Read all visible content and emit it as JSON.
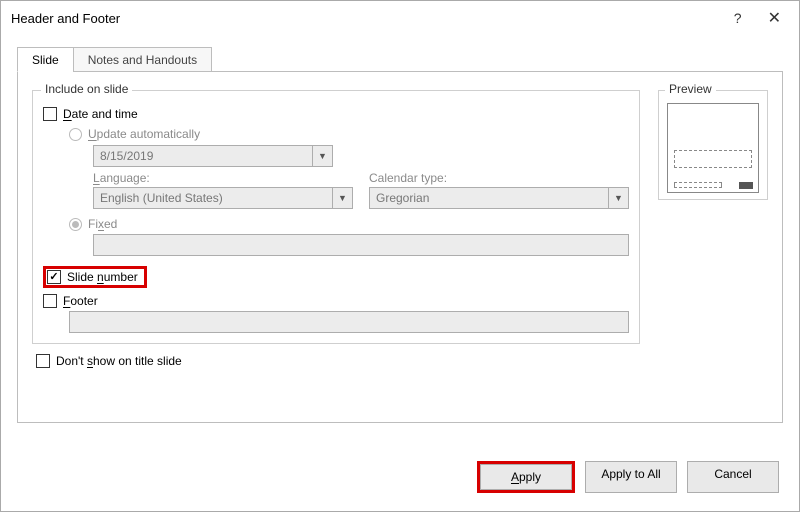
{
  "title": "Header and Footer",
  "tabs": {
    "slide": "Slide",
    "notes": "Notes and Handouts"
  },
  "group": {
    "include": "Include on slide",
    "preview": "Preview"
  },
  "fields": {
    "date_time": "Date and time",
    "update_auto": "Update automatically",
    "date_value": "8/15/2019",
    "language_label": "Language:",
    "language_value": "English (United States)",
    "calendar_label": "Calendar type:",
    "calendar_value": "Gregorian",
    "fixed": "Fixed",
    "slide_number": "Slide number",
    "footer": "Footer",
    "dont_show": "Don't show on title slide"
  },
  "buttons": {
    "apply": "Apply",
    "apply_all": "Apply to All",
    "cancel": "Cancel"
  }
}
